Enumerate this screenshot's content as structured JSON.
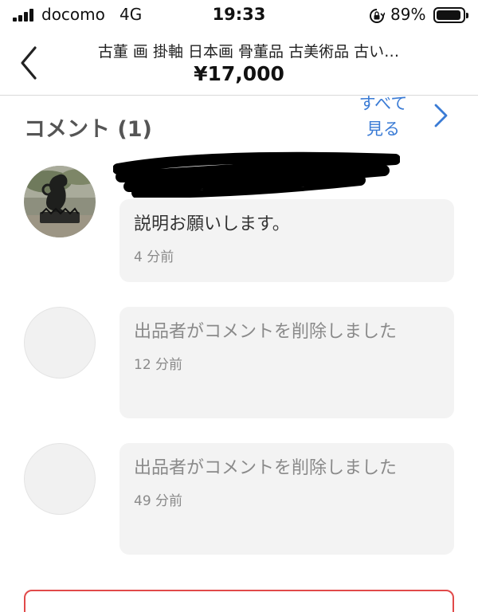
{
  "status_bar": {
    "carrier": "docomo",
    "network": "4G",
    "time": "19:33",
    "battery": "89%"
  },
  "header": {
    "title": "古董 画 掛軸 日本画 骨董品 古美術品 古い…",
    "price": "¥17,000"
  },
  "comments_section": {
    "heading": "コメント (1)",
    "see_all": "すべて\n見る",
    "accent_color": "#3a7bd5",
    "comments": [
      {
        "text": "説明お願いします。",
        "time": "4 分前"
      },
      {
        "text": "出品者がコメントを削除しました",
        "time": "12 分前"
      },
      {
        "text": "出品者がコメントを削除しました",
        "time": "49 分前"
      }
    ]
  }
}
